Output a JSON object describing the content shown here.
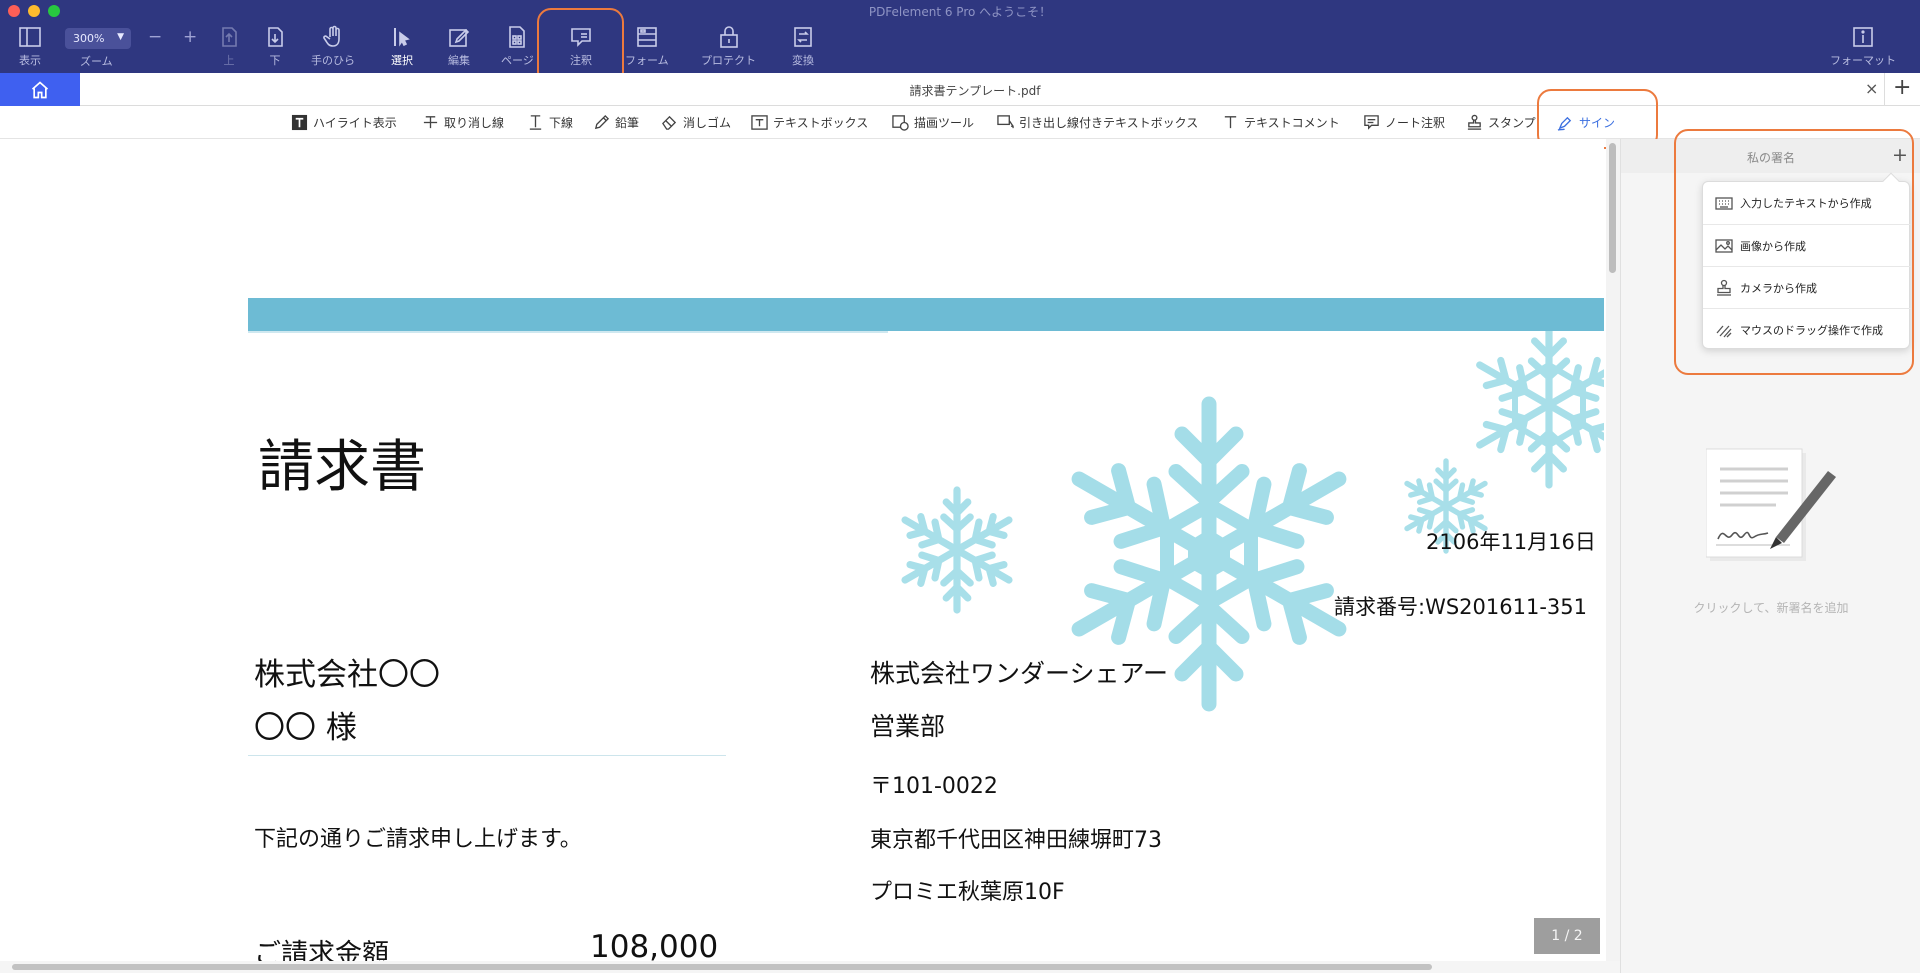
{
  "window": {
    "title": "PDFelement 6 Pro へようこそ！"
  },
  "toolbar": {
    "view_label": "表示",
    "zoom_value": "300%",
    "zoom_label": "ズーム",
    "zoom_out": "−",
    "zoom_in": "+",
    "up_label": "上",
    "down_label": "下",
    "hand_label": "手のひら",
    "select_label": "選択",
    "edit_label": "編集",
    "page_label": "ページ",
    "comment_label": "注釈",
    "form_label": "フォーム",
    "protect_label": "プロテクト",
    "convert_label": "変換",
    "format_label": "フォーマット"
  },
  "tabs": {
    "file_name": "請求書テンプレート.pdf",
    "close": "×",
    "add": "+"
  },
  "annotation_toolbar": {
    "items": [
      {
        "label": "ハイライト表示",
        "icon": "highlight-icon"
      },
      {
        "label": "取り消し線",
        "icon": "strikethrough-icon"
      },
      {
        "label": "下線",
        "icon": "underline-icon"
      },
      {
        "label": "鉛筆",
        "icon": "pencil-icon"
      },
      {
        "label": "消しゴム",
        "icon": "eraser-icon"
      },
      {
        "label": "テキストボックス",
        "icon": "textbox-icon"
      },
      {
        "label": "描画ツール",
        "icon": "draw-shape-icon"
      },
      {
        "label": "引き出し線付きテキストボックス",
        "icon": "callout-icon"
      },
      {
        "label": "テキストコメント",
        "icon": "text-comment-icon"
      },
      {
        "label": "ノート注釈",
        "icon": "note-icon"
      },
      {
        "label": "スタンプ",
        "icon": "stamp-icon"
      },
      {
        "label": "サイン",
        "icon": "sign-pen-icon",
        "active": true
      }
    ]
  },
  "document": {
    "title": "請求書",
    "date": "2106年11月16日",
    "invoice_number": "請求番号:WS201611-351",
    "client_company": "株式会社〇〇",
    "client_name": "〇〇 様",
    "greeting": "下記の通りご請求申し上げます。",
    "amount_label": "ご請求金額",
    "amount_value": "108,000",
    "sender_company": "株式会社ワンダーシェアー",
    "sender_department": "営業部",
    "sender_zip": "〒101-0022",
    "sender_address": "東京都千代田区神田練塀町73",
    "sender_building": "プロミエ秋葉原10F",
    "band_color": "#6dbbd4",
    "snowflake_color": "#9fdbe6"
  },
  "page_indicator": "1 / 2",
  "signature_panel": {
    "title": "私の署名",
    "add": "+",
    "menu": [
      {
        "label": "入力したテキストから作成",
        "icon": "keyboard-icon"
      },
      {
        "label": "画像から作成",
        "icon": "image-icon"
      },
      {
        "label": "カメラから作成",
        "icon": "stamp-icon"
      },
      {
        "label": "マウスのドラッグ操作で作成",
        "icon": "signature-draw-icon"
      }
    ],
    "hint": "クリックして、新署名を追加"
  },
  "colors": {
    "toolbar_bg": "#2f3780",
    "home_tab": "#3f60f0",
    "highlight_ring": "#ec7a3e",
    "active_tool": "#3b6fe0"
  }
}
